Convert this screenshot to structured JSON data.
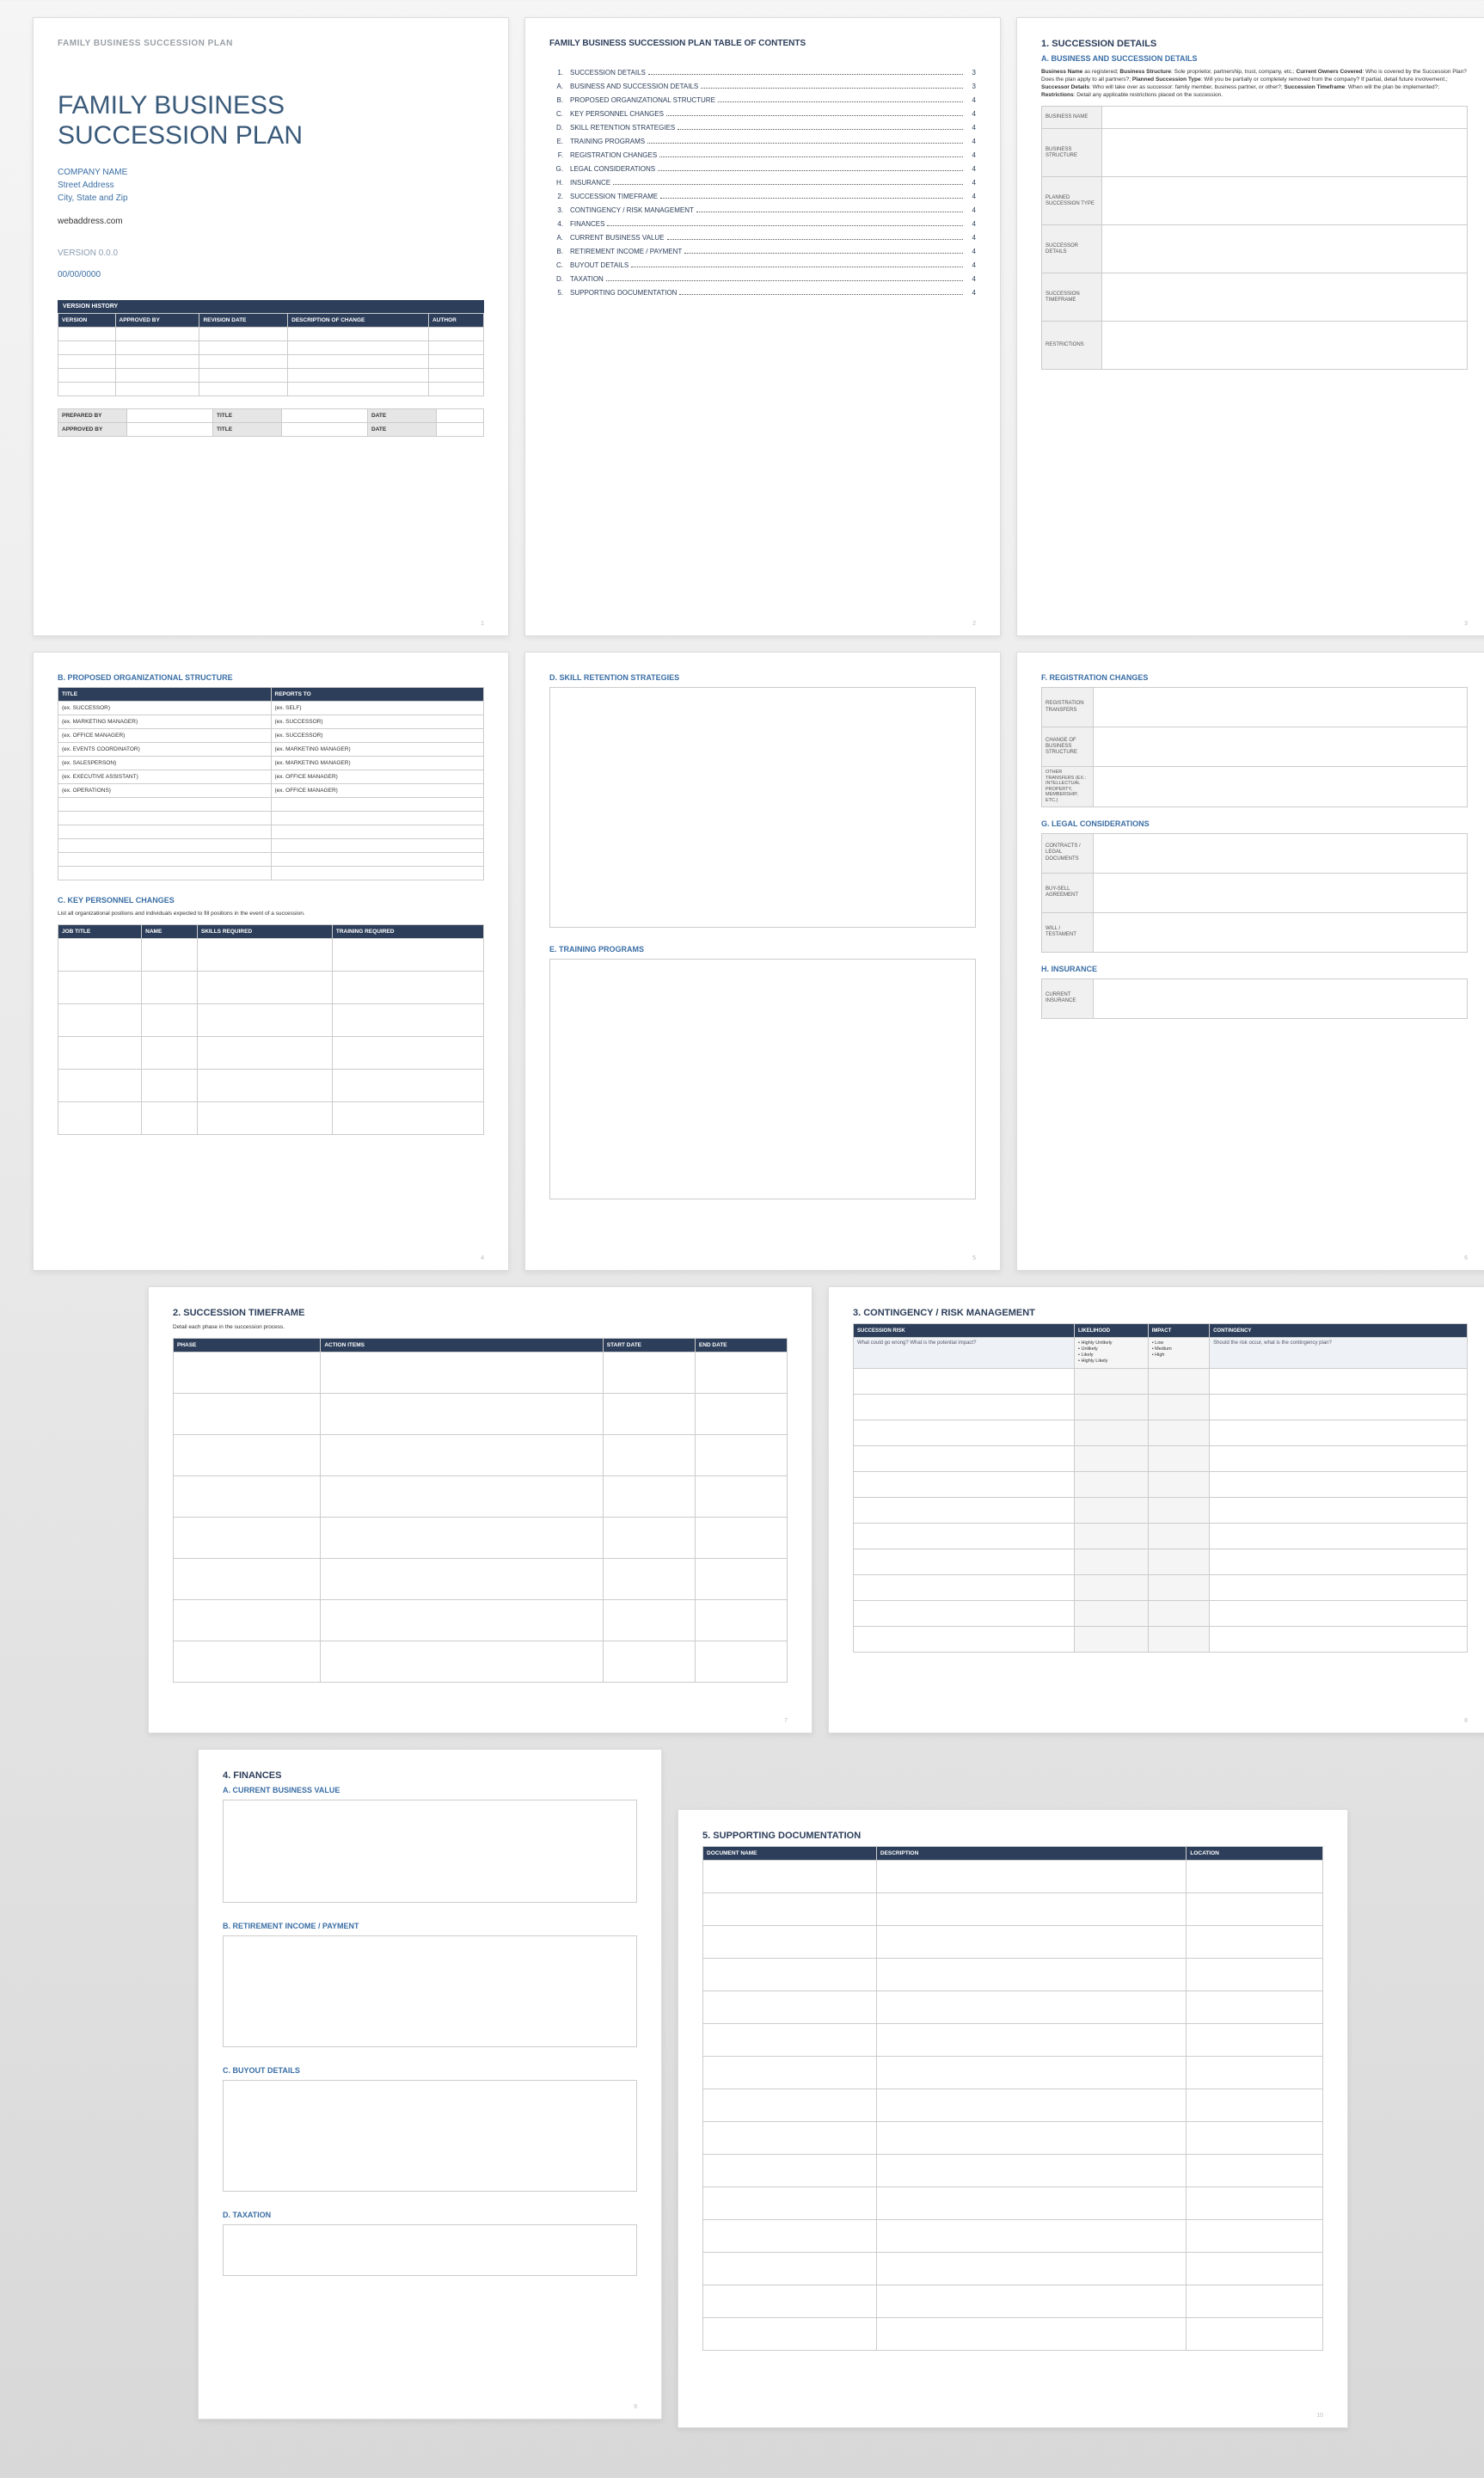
{
  "cover": {
    "header": "FAMILY BUSINESS SUCCESSION PLAN",
    "title_l1": "FAMILY BUSINESS",
    "title_l2": "SUCCESSION PLAN",
    "company": "COMPANY NAME",
    "address1": "Street Address",
    "address2": "City, State and Zip",
    "web": "webaddress.com",
    "version": "VERSION 0.0.0",
    "date": "00/00/0000",
    "version_history_caption": "VERSION HISTORY",
    "vh_cols": [
      "VERSION",
      "APPROVED BY",
      "REVISION DATE",
      "DESCRIPTION OF CHANGE",
      "AUTHOR"
    ],
    "sign": {
      "prepared_by": "PREPARED BY",
      "approved_by": "APPROVED BY",
      "title": "TITLE",
      "date": "DATE"
    }
  },
  "toc": {
    "header": "FAMILY BUSINESS SUCCESSION PLAN TABLE OF CONTENTS",
    "items": [
      {
        "n": "1.",
        "t": "SUCCESSION DETAILS",
        "p": "3"
      },
      {
        "n": "A.",
        "t": "BUSINESS AND SUCCESSION DETAILS",
        "p": "3"
      },
      {
        "n": "B.",
        "t": "PROPOSED ORGANIZATIONAL STRUCTURE",
        "p": "4"
      },
      {
        "n": "C.",
        "t": "KEY PERSONNEL CHANGES",
        "p": "4"
      },
      {
        "n": "D.",
        "t": "SKILL RETENTION STRATEGIES",
        "p": "4"
      },
      {
        "n": "E.",
        "t": "TRAINING PROGRAMS",
        "p": "4"
      },
      {
        "n": "F.",
        "t": "REGISTRATION CHANGES",
        "p": "4"
      },
      {
        "n": "G.",
        "t": "LEGAL CONSIDERATIONS",
        "p": "4"
      },
      {
        "n": "H.",
        "t": "INSURANCE",
        "p": "4"
      },
      {
        "n": "2.",
        "t": "SUCCESSION TIMEFRAME",
        "p": "4"
      },
      {
        "n": "3.",
        "t": "CONTINGENCY / RISK MANAGEMENT",
        "p": "4"
      },
      {
        "n": "4.",
        "t": "FINANCES",
        "p": "4"
      },
      {
        "n": "A.",
        "t": "CURRENT BUSINESS VALUE",
        "p": "4"
      },
      {
        "n": "B.",
        "t": "RETIREMENT INCOME / PAYMENT",
        "p": "4"
      },
      {
        "n": "C.",
        "t": "BUYOUT DETAILS",
        "p": "4"
      },
      {
        "n": "D.",
        "t": "TAXATION",
        "p": "4"
      },
      {
        "n": "5.",
        "t": "SUPPORTING DOCUMENTATION",
        "p": "4"
      }
    ]
  },
  "p3": {
    "sec": "1.  SUCCESSION DETAILS",
    "sub": "A.  BUSINESS AND SUCCESSION DETAILS",
    "instr_parts": {
      "b1": "Business Name",
      "t1": " as registered; ",
      "b2": "Business Structure",
      "t2": ": Sole proprietor, partnership, trust, company, etc.; ",
      "b3": "Current Owners Covered",
      "t3": ": Who is covered by the Succession Plan? Does the plan apply to all partners?; ",
      "b4": "Planned Succession Type",
      "t4": ": Will you be partially or completely removed from the company? If partial, detail future involvement.; ",
      "b5": "Successor Details",
      "t5": ": Who will take over as successor: family member, business partner, or other?; ",
      "b6": "Succession Timeframe",
      "t6": ": When will the plan be implemented?; ",
      "b7": "Restrictions",
      "t7": ": Detail any applicable restrictions placed on the succession."
    },
    "rows": [
      "BUSINESS NAME",
      "BUSINESS STRUCTURE",
      "PLANNED SUCCESSION TYPE",
      "SUCCESSOR DETAILS",
      "SUCCESSION TIMEFRAME",
      "RESTRICTIONS"
    ]
  },
  "p4": {
    "subB": "B.  PROPOSED ORGANIZATIONAL STRUCTURE",
    "org_cols": [
      "TITLE",
      "REPORTS TO"
    ],
    "org_rows": [
      [
        "(ex. SUCCESSOR)",
        "(ex. SELF)"
      ],
      [
        "(ex. MARKETING MANAGER)",
        "(ex. SUCCESSOR)"
      ],
      [
        "(ex. OFFICE MANAGER)",
        "(ex. SUCCESSOR)"
      ],
      [
        "(ex. EVENTS COORDINATOR)",
        "(ex. MARKETING MANAGER)"
      ],
      [
        "(ex. SALESPERSON)",
        "(ex. MARKETING MANAGER)"
      ],
      [
        "(ex. EXECUTIVE ASSISTANT)",
        "(ex. OFFICE MANAGER)"
      ],
      [
        "(ex. OPERATIONS)",
        "(ex. OFFICE MANAGER)"
      ]
    ],
    "subC": "C.  KEY PERSONNEL CHANGES",
    "subC_instr": "List all organizational positions and individuals expected to fill positions in the event of a succession.",
    "kp_cols": [
      "JOB TITLE",
      "NAME",
      "SKILLS REQUIRED",
      "TRAINING REQUIRED"
    ]
  },
  "p5": {
    "subD": "D.  SKILL RETENTION STRATEGIES",
    "subE": "E.  TRAINING PROGRAMS"
  },
  "p6": {
    "subF": "F.  REGISTRATION CHANGES",
    "f_rows": [
      "REGISTRATION TRANSFERS",
      "CHANGE OF BUSINESS STRUCTURE",
      "OTHER TRANSFERS (ex.: intellectual property, membership, etc.)"
    ],
    "subG": "G.  LEGAL CONSIDERATIONS",
    "g_rows": [
      "CONTRACTS / LEGAL DOCUMENTS",
      "BUY-SELL AGREEMENT",
      "WILL / TESTAMENT"
    ],
    "subH": "H.  INSURANCE",
    "h_row": "CURRENT INSURANCE"
  },
  "p7": {
    "sec": "2.  SUCCESSION TIMEFRAME",
    "instr": "Detail each phase in the succession process.",
    "cols": [
      "PHASE",
      "ACTION ITEMS",
      "START DATE",
      "END DATE"
    ]
  },
  "p8": {
    "sec": "3.  CONTINGENCY / RISK MANAGEMENT",
    "cols": [
      "SUCCESSION RISK",
      "LIKELIHOOD",
      "IMPACT",
      "CONTINGENCY"
    ],
    "prompt_risk": "What could go wrong? What is the potential impact?",
    "likelihood_opts": "• Highly Unlikely\n• Unlikely\n• Likely\n• Highly Likely",
    "impact_opts": "• Low\n• Medium\n• High",
    "prompt_cont": "Should the risk occur, what is the contingency plan?"
  },
  "p9": {
    "sec": "4.  FINANCES",
    "subA": "A.  CURRENT BUSINESS VALUE",
    "subB": "B.  RETIREMENT INCOME / PAYMENT",
    "subC": "C.  BUYOUT DETAILS",
    "subD": "D.  TAXATION"
  },
  "p10": {
    "sec": "5.  SUPPORTING DOCUMENTATION",
    "cols": [
      "DOCUMENT NAME",
      "DESCRIPTION",
      "LOCATION"
    ]
  },
  "page_numbers": [
    "1",
    "2",
    "3",
    "4",
    "5",
    "6",
    "7",
    "8",
    "9",
    "10"
  ]
}
